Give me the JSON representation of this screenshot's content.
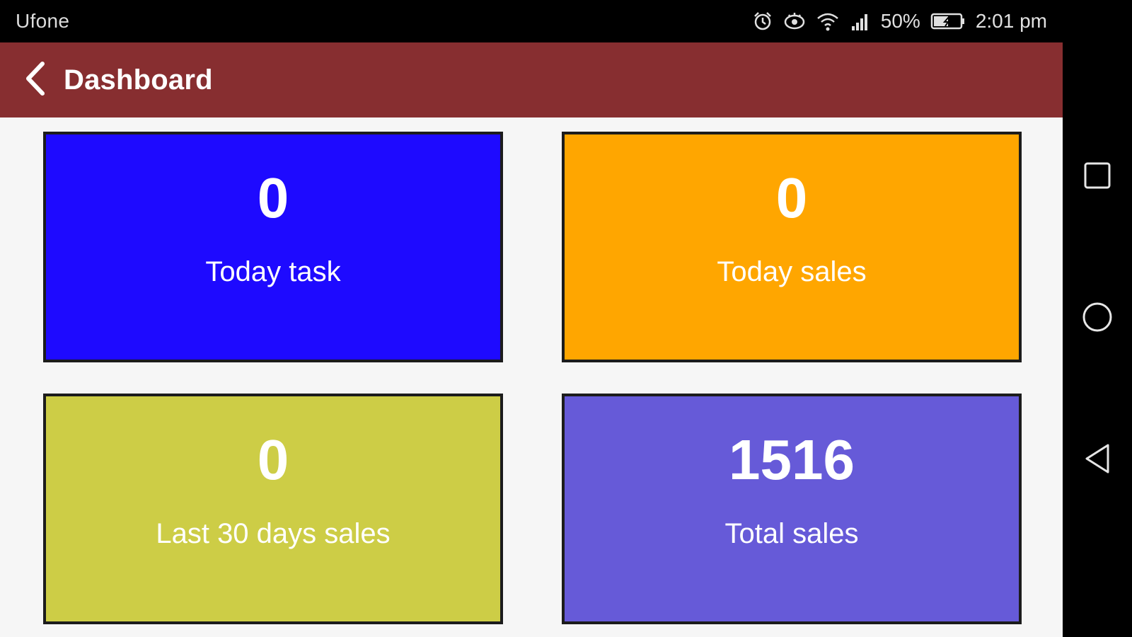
{
  "status_bar": {
    "carrier": "Ufone",
    "battery_percent": "50%",
    "time": "2:01 pm",
    "icons": [
      "alarm-icon",
      "eye-icon",
      "wifi-icon",
      "signal-icon",
      "battery-icon"
    ]
  },
  "app_bar": {
    "title": "Dashboard",
    "back_icon": "chevron-left-icon",
    "color": "#872e30"
  },
  "cards": [
    {
      "value": "0",
      "label": "Today task",
      "color": "#1e0aff"
    },
    {
      "value": "0",
      "label": "Today sales",
      "color": "#ffa600"
    },
    {
      "value": "0",
      "label": "Last 30 days sales",
      "color": "#cdcd46"
    },
    {
      "value": "1516",
      "label": "Total sales",
      "color": "#665ad8"
    }
  ],
  "nav_bar": {
    "icons": [
      "recent-apps-icon",
      "home-icon",
      "back-triangle-icon"
    ]
  }
}
